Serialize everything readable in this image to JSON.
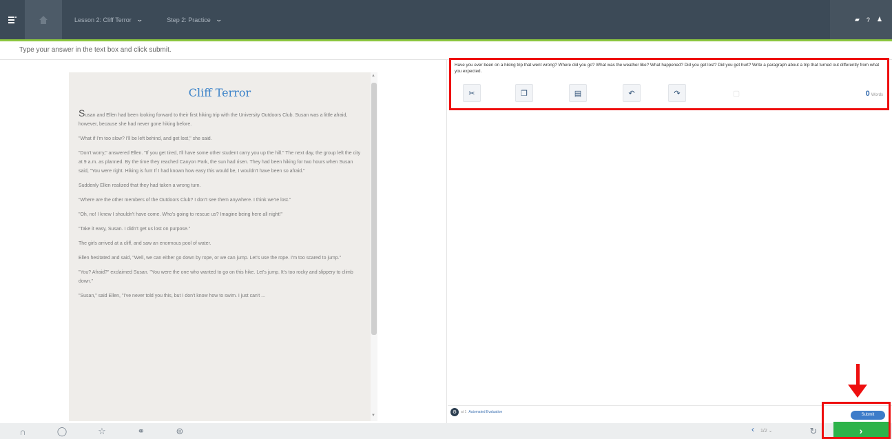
{
  "topbar": {
    "breadcrumb_lesson": "Lesson 2: Cliff Terror",
    "breadcrumb_step": "Step 2: Practice",
    "right_icons": [
      "flag-icon",
      "help-icon",
      "user-icon"
    ],
    "help_label": "?"
  },
  "instruction": "Type your answer in the text box and click submit.",
  "reading": {
    "title": "Cliff Terror",
    "paragraphs": [
      "Susan and Ellen had been looking forward to their first hiking trip with the University Outdoors Club. Susan was a little afraid, however, because she had never gone hiking before.",
      "\"What if I'm too slow? I'll be left behind, and get lost,\" she said.",
      "\"Don't worry,\" answered Ellen. \"If you get tired, I'll have some other student carry you up the hill.\" The next day, the group left the city at 9 a.m. as planned. By the time they reached Canyon Park, the sun had risen. They had been hiking for two hours when Susan said, \"You were right. Hiking is fun! If I had known how easy this would be, I wouldn't have been so afraid.\"",
      "Suddenly Ellen realized that they had taken a wrong turn.",
      "\"Where are the other members of the Outdoors Club? I don't see them anywhere. I think we're lost.\"",
      "\"Oh, no! I knew I shouldn't have come. Who's going to rescue us? Imagine being here all night!\"",
      "\"Take it easy, Susan. I didn't get us lost on purpose.\"",
      "The girls arrived at a cliff, and saw an enormous pool of water.",
      "Ellen hesitated and said, \"Well, we can either go down by rope, or we can jump. Let's use the rope. I'm too scared to jump.\"",
      "\"You? Afraid?\" exclaimed Susan. \"You were the one who wanted to go on this hike. Let's jump. It's too rocky and slippery to climb down.\"",
      "\"Susan,\" said Ellen, \"I've never told you this, but I don't know how to swim. I just can't ..."
    ]
  },
  "question": {
    "prompt": "Have you ever been on a hiking trip that went wrong? Where did you go? What was the weather like? What happened? Did you get lost? Did you get hurt? Write a paragraph about a trip that turned out differently from what you expected.",
    "toolbar": [
      "cut-icon",
      "copy-icon",
      "paste-icon",
      "undo-icon",
      "redo-icon",
      "clear-icon"
    ],
    "word_count": "0",
    "word_count_label": "Words"
  },
  "auto_eval": {
    "label": "Automated Evaluation",
    "prefix": "at 1"
  },
  "bottom": {
    "icons": [
      "headphones-icon",
      "comment-icon",
      "star-icon",
      "link-icon",
      "print-icon"
    ],
    "pager": "1/2",
    "submit_label": "Submit",
    "next_label": "›"
  },
  "colors": {
    "topbar": "#3c4a57",
    "accent_green": "#8cc63f",
    "title_blue": "#3c83c9",
    "next_green": "#2db34a",
    "annotation_red": "#ee0f0f"
  }
}
